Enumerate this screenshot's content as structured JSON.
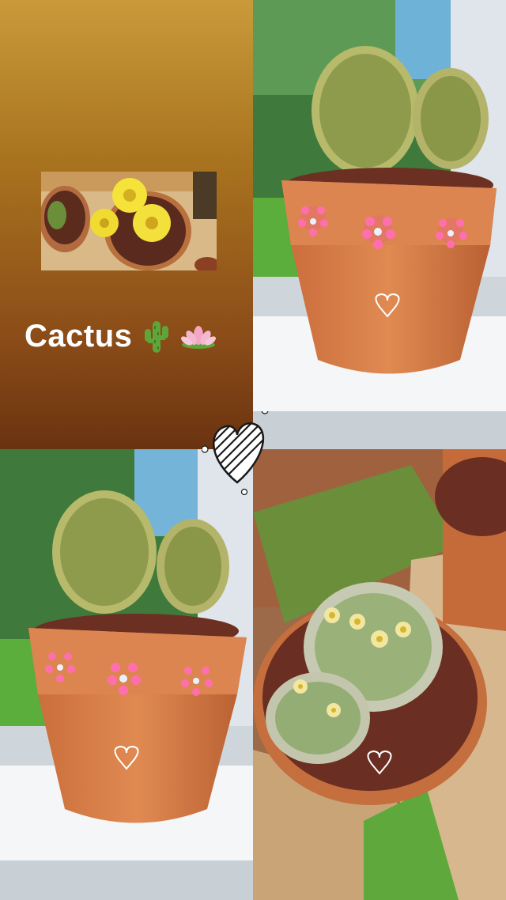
{
  "title": {
    "text": "Cactus",
    "cactus_icon": "cactus-emoji",
    "lotus_icon": "lotus-emoji"
  },
  "photos": [
    {
      "subject": "cactus-thumbnail-collage"
    },
    {
      "subject": "potted-cactus-window"
    },
    {
      "subject": "potted-cactus-window-repeat"
    },
    {
      "subject": "flowering-mammillaria-pot"
    }
  ],
  "sticker": {
    "icon": "heart-sticker-icon"
  },
  "colors": {
    "pot": "#d9814a",
    "gradient_top": "#c99a3a",
    "gradient_bottom": "#6a3310",
    "dots": "#f2559a"
  }
}
